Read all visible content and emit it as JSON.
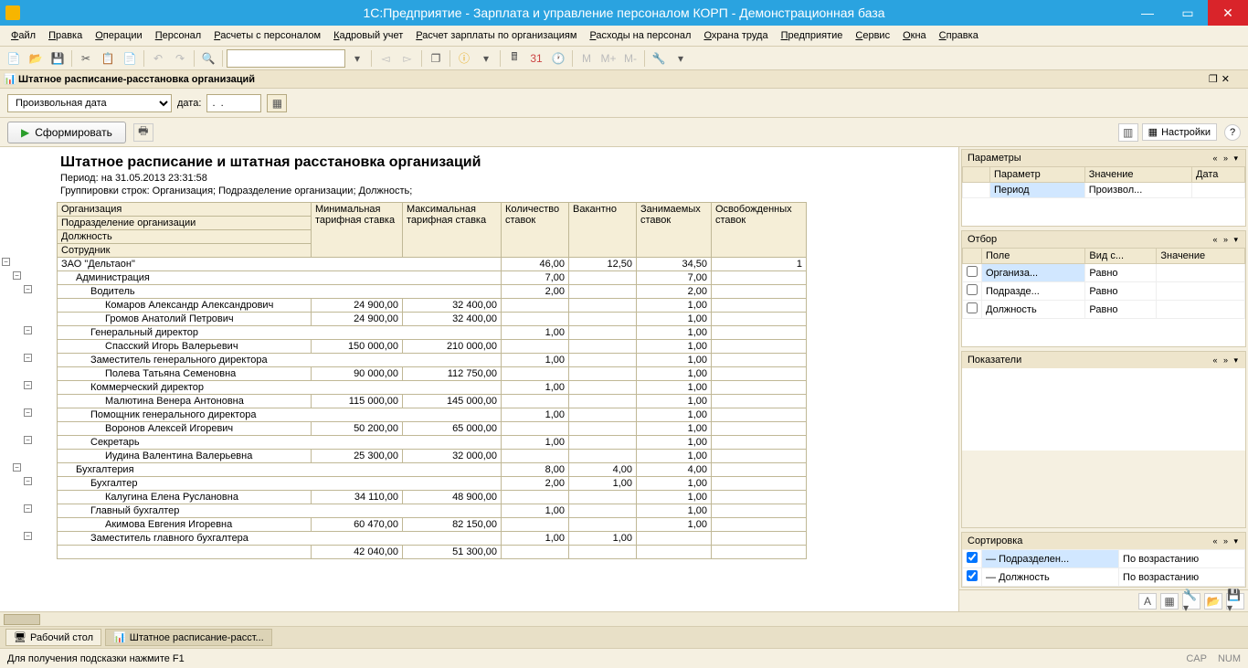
{
  "title": "1С:Предприятие - Зарплата и управление персоналом КОРП - Демонстрационная база",
  "menu": [
    "Файл",
    "Правка",
    "Операции",
    "Персонал",
    "Расчеты с персоналом",
    "Кадровый учет",
    "Расчет зарплаты по организациям",
    "Расходы на персонал",
    "Охрана труда",
    "Предприятие",
    "Сервис",
    "Окна",
    "Справка"
  ],
  "subtitle": "Штатное расписание-расстановка организаций",
  "period_combo": "Произвольная дата",
  "date_label": "дата:",
  "date_value": " .  .",
  "form_button": "Сформировать",
  "settings_label": "Настройки",
  "report": {
    "title": "Штатное расписание и штатная расстановка организаций",
    "period": "Период: на 31.05.2013 23:31:58",
    "groupings": "Группировки строк: Организация; Подразделение организации; Должность;",
    "hdr_org": "Организация",
    "hdr_dept": "Подразделение организации",
    "hdr_pos": "Должность",
    "hdr_emp": "Сотрудник",
    "hdr_min": "Минимальная тарифная ставка",
    "hdr_max": "Максимальная тарифная ставка",
    "hdr_count": "Количество ставок",
    "hdr_vacant": "Вакантно",
    "hdr_occupied": "Занимаемых ставок",
    "hdr_freed": "Освобожденных ставок",
    "rows": [
      {
        "ind": 0,
        "name": "ЗАО \"Дельтаон\"",
        "min": "",
        "max": "",
        "c": "46,00",
        "v": "12,50",
        "o": "34,50",
        "f": "1"
      },
      {
        "ind": 1,
        "name": "Администрация",
        "min": "",
        "max": "",
        "c": "7,00",
        "v": "",
        "o": "7,00",
        "f": ""
      },
      {
        "ind": 2,
        "name": "Водитель",
        "min": "",
        "max": "",
        "c": "2,00",
        "v": "",
        "o": "2,00",
        "f": ""
      },
      {
        "ind": 3,
        "name": "Комаров Александр Александрович",
        "min": "24 900,00",
        "max": "32 400,00",
        "c": "",
        "v": "",
        "o": "1,00",
        "f": ""
      },
      {
        "ind": 3,
        "name": "Громов Анатолий Петрович",
        "min": "24 900,00",
        "max": "32 400,00",
        "c": "",
        "v": "",
        "o": "1,00",
        "f": ""
      },
      {
        "ind": 2,
        "name": "Генеральный директор",
        "min": "",
        "max": "",
        "c": "1,00",
        "v": "",
        "o": "1,00",
        "f": ""
      },
      {
        "ind": 3,
        "name": "Спасский Игорь Валерьевич",
        "min": "150 000,00",
        "max": "210 000,00",
        "c": "",
        "v": "",
        "o": "1,00",
        "f": ""
      },
      {
        "ind": 2,
        "name": "Заместитель генерального директора",
        "min": "",
        "max": "",
        "c": "1,00",
        "v": "",
        "o": "1,00",
        "f": ""
      },
      {
        "ind": 3,
        "name": "Полева Татьяна Семеновна",
        "min": "90 000,00",
        "max": "112 750,00",
        "c": "",
        "v": "",
        "o": "1,00",
        "f": ""
      },
      {
        "ind": 2,
        "name": "Коммерческий директор",
        "min": "",
        "max": "",
        "c": "1,00",
        "v": "",
        "o": "1,00",
        "f": ""
      },
      {
        "ind": 3,
        "name": "Малютина Венера Антоновна",
        "min": "115 000,00",
        "max": "145 000,00",
        "c": "",
        "v": "",
        "o": "1,00",
        "f": ""
      },
      {
        "ind": 2,
        "name": "Помощник генерального директора",
        "min": "",
        "max": "",
        "c": "1,00",
        "v": "",
        "o": "1,00",
        "f": ""
      },
      {
        "ind": 3,
        "name": "Воронов Алексей Игоревич",
        "min": "50 200,00",
        "max": "65 000,00",
        "c": "",
        "v": "",
        "o": "1,00",
        "f": ""
      },
      {
        "ind": 2,
        "name": "Секретарь",
        "min": "",
        "max": "",
        "c": "1,00",
        "v": "",
        "o": "1,00",
        "f": ""
      },
      {
        "ind": 3,
        "name": "Иудина Валентина Валерьевна",
        "min": "25 300,00",
        "max": "32 000,00",
        "c": "",
        "v": "",
        "o": "1,00",
        "f": ""
      },
      {
        "ind": 1,
        "name": "Бухгалтерия",
        "min": "",
        "max": "",
        "c": "8,00",
        "v": "4,00",
        "o": "4,00",
        "f": ""
      },
      {
        "ind": 2,
        "name": "Бухгалтер",
        "min": "",
        "max": "",
        "c": "2,00",
        "v": "1,00",
        "o": "1,00",
        "f": ""
      },
      {
        "ind": 3,
        "name": "Калугина Елена Руслановна",
        "min": "34 110,00",
        "max": "48 900,00",
        "c": "",
        "v": "",
        "o": "1,00",
        "f": ""
      },
      {
        "ind": 2,
        "name": "Главный бухгалтер",
        "min": "",
        "max": "",
        "c": "1,00",
        "v": "",
        "o": "1,00",
        "f": ""
      },
      {
        "ind": 3,
        "name": "Акимова Евгения Игоревна",
        "min": "60 470,00",
        "max": "82 150,00",
        "c": "",
        "v": "",
        "o": "1,00",
        "f": ""
      },
      {
        "ind": 2,
        "name": "Заместитель главного бухгалтера",
        "min": "",
        "max": "",
        "c": "1,00",
        "v": "1,00",
        "o": "",
        "f": ""
      },
      {
        "ind": 3,
        "name": "",
        "min": "42 040,00",
        "max": "51 300,00",
        "c": "",
        "v": "",
        "o": "",
        "f": ""
      }
    ]
  },
  "side": {
    "params_title": "Параметры",
    "params_cols": [
      "Параметр",
      "Значение",
      "Дата"
    ],
    "params_rows": [
      [
        "Период",
        "Произвол...",
        ""
      ]
    ],
    "filter_title": "Отбор",
    "filter_cols": [
      "Поле",
      "Вид с...",
      "Значение"
    ],
    "filter_rows": [
      [
        "Организа...",
        "Равно",
        ""
      ],
      [
        "Подразде...",
        "Равно",
        ""
      ],
      [
        "Должность",
        "Равно",
        ""
      ]
    ],
    "indicators_title": "Показатели",
    "sort_title": "Сортировка",
    "sort_rows": [
      [
        "Подразделен...",
        "По возрастанию"
      ],
      [
        "Должность",
        "По возрастанию"
      ]
    ]
  },
  "taskbar": {
    "desktop": "Рабочий стол",
    "tab": "Штатное расписание-расст..."
  },
  "status": {
    "hint": "Для получения подсказки нажмите F1",
    "cap": "CAP",
    "num": "NUM"
  }
}
